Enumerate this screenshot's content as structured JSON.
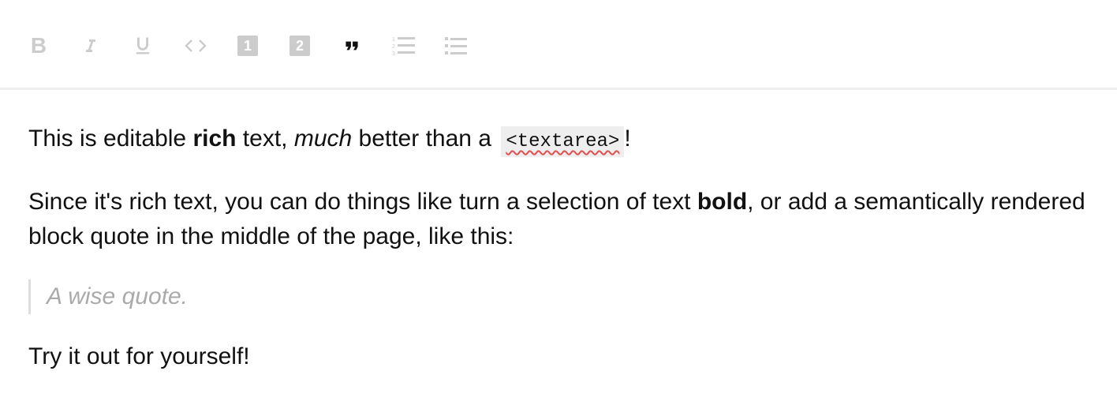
{
  "toolbar": {
    "buttons": [
      {
        "name": "bold",
        "icon": "format-bold-icon",
        "active": false
      },
      {
        "name": "italic",
        "icon": "format-italic-icon",
        "active": false
      },
      {
        "name": "underline",
        "icon": "format-underline-icon",
        "active": false
      },
      {
        "name": "code",
        "icon": "code-icon",
        "active": false
      },
      {
        "name": "heading-one",
        "icon": "looks-one-icon",
        "active": false
      },
      {
        "name": "heading-two",
        "icon": "looks-two-icon",
        "active": false
      },
      {
        "name": "block-quote",
        "icon": "format-quote-icon",
        "active": true
      },
      {
        "name": "numbered-list",
        "icon": "format-list-numbered-icon",
        "active": false
      },
      {
        "name": "bulleted-list",
        "icon": "format-list-bulleted-icon",
        "active": false
      }
    ],
    "glyphs": {
      "bold": "B",
      "heading_one": "1",
      "heading_two": "2"
    },
    "colors": {
      "inactive": "#cccccc",
      "active": "#111111"
    }
  },
  "editor": {
    "p1": {
      "t1": "This is editable ",
      "bold": "rich",
      "t2": " text, ",
      "italic": "much",
      "t3": " better than a ",
      "code": "<textarea>",
      "t4": "!"
    },
    "p2": {
      "t1": "Since it's rich text, you can do things like turn a selection of text ",
      "bold": "bold",
      "t2": ", or add a semantically rendered block quote in the middle of the page, like this:"
    },
    "quote": "A wise quote.",
    "p3": "Try it out for yourself!"
  }
}
